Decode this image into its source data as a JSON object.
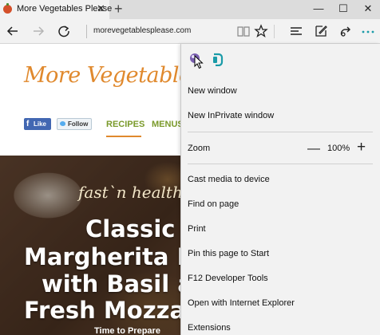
{
  "tab": {
    "title": "More Vegetables Please",
    "close_glyph": "✕",
    "new_tab_glyph": "+"
  },
  "window_controls": {
    "minimize_glyph": "—",
    "maximize_glyph": "☐",
    "close_glyph": "✕"
  },
  "toolbar": {
    "address": "morevegetablesplease.com",
    "icons": [
      "back-icon",
      "forward-icon",
      "refresh-icon",
      "reading-view-icon",
      "favorite-star-icon",
      "hub-icon",
      "web-note-icon",
      "share-icon",
      "more-icon"
    ]
  },
  "page": {
    "logo": "More Vegetables P",
    "fb_like": "Like",
    "tw_follow": "Follow",
    "nav_recipes": "RECIPES",
    "nav_menus": "MENUS",
    "hero": {
      "script": "fast`n healthy",
      "line1": "Classic",
      "line2": "Margherita F",
      "line3": "with Basil a",
      "line4": "Fresh Mozza",
      "time": "Time to Prepare"
    }
  },
  "menu": {
    "top_icons": [
      "color-picker-icon",
      "extension-icon"
    ],
    "new_window": "New window",
    "new_inprivate": "New InPrivate window",
    "zoom_label": "Zoom",
    "zoom_minus": "—",
    "zoom_value": "100%",
    "zoom_plus": "+",
    "cast": "Cast media to device",
    "find": "Find on page",
    "print": "Print",
    "pin": "Pin this page to Start",
    "devtools": "F12 Developer Tools",
    "open_ie": "Open with Internet Explorer",
    "extensions": "Extensions"
  },
  "colors": {
    "logo": "#e0892d",
    "nav": "#7a9a2a",
    "accent_teal": "#1a9ba8",
    "chrome": "#f2f2f2"
  }
}
